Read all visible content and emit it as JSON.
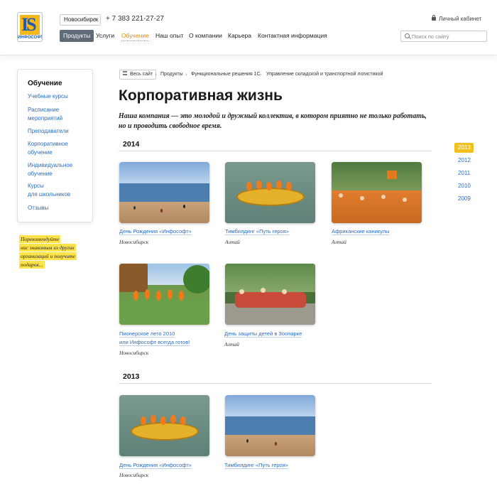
{
  "header": {
    "logo_text": "ИНФОСОФТ",
    "city": "Новосибирск",
    "phone": "+ 7 383 221-27-27",
    "cabinet": "Личный кабинет",
    "search_placeholder": "Поиск по сайту",
    "nav": [
      {
        "label": "Продукты",
        "state": "active"
      },
      {
        "label": "Услуги",
        "state": "normal"
      },
      {
        "label": "Обучение",
        "state": "current"
      },
      {
        "label": "Наш опыт",
        "state": "normal"
      },
      {
        "label": "О компании",
        "state": "normal"
      },
      {
        "label": "Карьера",
        "state": "normal"
      },
      {
        "label": "Контактная информация",
        "state": "normal"
      }
    ]
  },
  "sidebar": {
    "title": "Обучение",
    "items": [
      {
        "line1": "Учебные курсы",
        "line2": ""
      },
      {
        "line1": "Расписание",
        "line2": "мероприятий"
      },
      {
        "line1": "Преподаватели",
        "line2": ""
      },
      {
        "line1": "Корпоративное",
        "line2": "обучение"
      },
      {
        "line1": "Индивидуальное",
        "line2": "обучение"
      },
      {
        "line1": "Курсы",
        "line2": "для школьников"
      },
      {
        "line1": "Отзывы",
        "line2": ""
      }
    ],
    "note_lines": [
      "Порекомендуйте",
      "нас знакомым из других",
      "организаций и получите",
      "подарок..."
    ]
  },
  "breadcrumbs": {
    "all_site": "Весь сайт",
    "items": [
      "Продукты",
      "Функциональные решения 1С",
      "Управление складской и транспортной логистикой"
    ]
  },
  "page": {
    "title": "Корпоративная жизнь",
    "intro_line1": "Наша компания — это молодой и дружный коллектив, в котором приятно не только работать,",
    "intro_line2": "но и проводить свободное время."
  },
  "years": [
    {
      "year": "2014",
      "events": [
        {
          "title": "День Рождения «Инфософт»",
          "title2": "",
          "place": "Новосибирск",
          "photo": "beach"
        },
        {
          "title": "Тимбилдинг «Путь героя»",
          "title2": "",
          "place": "Алтай",
          "photo": "raft"
        },
        {
          "title": "Африканские каникулы",
          "title2": "",
          "place": "Алтай",
          "photo": "crowd"
        },
        {
          "title": "Пионерское лето 2010",
          "title2": "или Инфософт всегда готов!",
          "place": "Новосибирск",
          "photo": "camp"
        },
        {
          "title": "День защиты детей в Зоопарке",
          "title2": "",
          "place": "Алтай",
          "photo": "zoo"
        }
      ]
    },
    {
      "year": "2013",
      "events": [
        {
          "title": "День Рождения «Инфософт»",
          "title2": "",
          "place": "Новосибирск",
          "photo": "raft"
        },
        {
          "title": "Тимбилдинг «Путь героя»",
          "title2": "",
          "place": "",
          "photo": "beach"
        }
      ]
    }
  ],
  "year_rail": [
    {
      "label": "2013",
      "active": true
    },
    {
      "label": "2012",
      "active": false
    },
    {
      "label": "2011",
      "active": false
    },
    {
      "label": "2010",
      "active": false
    },
    {
      "label": "2009",
      "active": false
    }
  ],
  "colors": {
    "link": "#2b6cc4",
    "accent_yellow": "#f2c01e",
    "nav_active_bg": "#5f6b77",
    "nav_current": "#e08a1a"
  }
}
